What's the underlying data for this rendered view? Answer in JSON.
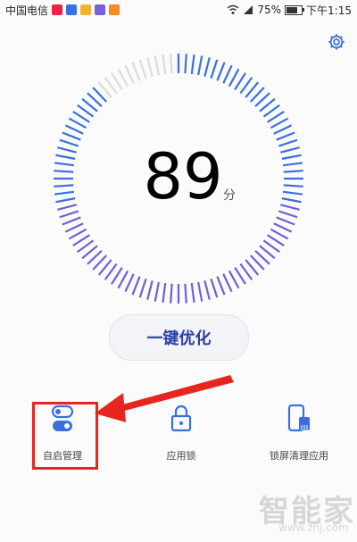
{
  "status_bar": {
    "carrier": "中国电信",
    "battery": "75%",
    "battery_level": 0.75,
    "time": "下午1:15"
  },
  "score": {
    "value": "89",
    "unit": "分",
    "level": 0.89
  },
  "optimize_label": "一键优化",
  "tools": [
    {
      "label": "自启管理",
      "icon": "toggle-switch-icon"
    },
    {
      "label": "应用锁",
      "icon": "lock-icon"
    },
    {
      "label": "锁屏清理应用",
      "icon": "phone-clean-icon"
    }
  ],
  "colors": {
    "gauge_active": "#3b6fe0",
    "gauge_purple": "#6e60d8",
    "gauge_inactive": "#dcdcdc",
    "accent": "#2a3fa6",
    "highlight": "#e5261f"
  },
  "watermark": {
    "text": "智能家",
    "sub": "www.znj.com"
  }
}
